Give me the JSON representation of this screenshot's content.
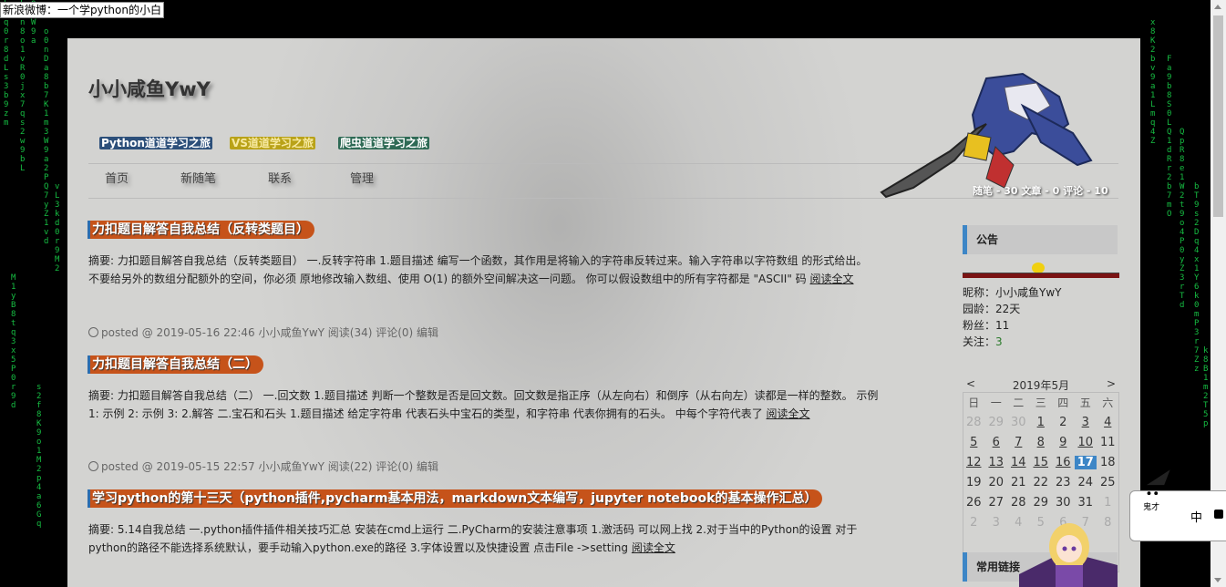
{
  "weibo_banner": "新浪微博：一个学python的小白",
  "blog": {
    "title": "小小咸鱼YwY",
    "categories": [
      {
        "label": "Python道道学习之旅",
        "bg": "#2c4f7a",
        "fg": "#ffffff"
      },
      {
        "label": "VS道道学习之旅",
        "bg": "#b9a218",
        "fg": "#f7e9a0"
      },
      {
        "label": "爬虫道道学习之旅",
        "bg": "#2e6a55",
        "fg": "#ffffff"
      }
    ],
    "nav": [
      "首页",
      "新随笔",
      "联系",
      "管理"
    ],
    "stats": "随笔 - 30  文章 - 0  评论 - 10"
  },
  "posts": [
    {
      "title": "力扣题目解答自我总结（反转类题目）",
      "summary": "摘要: 力扣题目解答自我总结（反转类题目） 一.反转字符串 1.题目描述 编写一个函数，其作用是将输入的字符串反转过来。输入字符串以字符数组 的形式给出。 不要给另外的数组分配额外的空间，你必须 原地修改输入数组、使用 O(1) 的额外空间解决这一问题。 你可以假设数组中的所有字符都是 \"ASCII\" 码",
      "read_more": "阅读全文",
      "meta": "posted @ 2019-05-16 22:46 小小咸鱼YwY 阅读(34) 评论(0) 编辑"
    },
    {
      "title": "力扣题目解答自我总结（二）",
      "summary": "摘要: 力扣题目解答自我总结（二） 一.回文数 1.题目描述 判断一个整数是否是回文数。回文数是指正序（从左向右）和倒序（从右向左）读都是一样的整数。 示例 1: 示例 2: 示例 3: 2.解答 二.宝石和石头 1.题目描述 给定字符串 代表石头中宝石的类型，和字符串 代表你拥有的石头。 中每个字符代表了",
      "read_more": "阅读全文",
      "meta": "posted @ 2019-05-15 22:57 小小咸鱼YwY 阅读(22) 评论(0) 编辑"
    },
    {
      "title": "学习python的第十三天（python插件,pycharm基本用法，markdown文本编写，jupyter notebook的基本操作汇总）",
      "summary": "摘要: 5.14自我总结 一.python插件插件相关技巧汇总 安装在cmd上运行 二.PyCharm的安装注意事项 1.激活码 可以网上找 2.对于当中的Python的设置 对于python的路径不能选择系统默认，要手动输入python.exe的路径 3.字体设置以及快捷设置 点击File ->setting",
      "read_more": "阅读全文"
    }
  ],
  "sidebar": {
    "notice_title": "公告",
    "profile": [
      {
        "k": "昵称：",
        "v": "小小咸鱼YwY"
      },
      {
        "k": "园龄：",
        "v": "22天"
      },
      {
        "k": "粉丝：",
        "v": "11"
      },
      {
        "k": "关注：",
        "v": "3"
      }
    ],
    "calendar": {
      "prev": "<",
      "title": "2019年5月",
      "next": ">",
      "weekdays": [
        "日",
        "一",
        "二",
        "三",
        "四",
        "五",
        "六"
      ],
      "weeks": [
        [
          "28",
          "29",
          "30",
          "1",
          "2",
          "3",
          "4"
        ],
        [
          "5",
          "6",
          "7",
          "8",
          "9",
          "10",
          "11"
        ],
        [
          "12",
          "13",
          "14",
          "15",
          "16",
          "17",
          "18"
        ],
        [
          "19",
          "20",
          "21",
          "22",
          "23",
          "24",
          "25"
        ],
        [
          "26",
          "27",
          "28",
          "29",
          "30",
          "31",
          "1"
        ],
        [
          "2",
          "3",
          "4",
          "5",
          "6",
          "7",
          "8"
        ]
      ],
      "today": "17"
    },
    "links_title": "常用链接"
  },
  "ime": {
    "label": "中"
  }
}
